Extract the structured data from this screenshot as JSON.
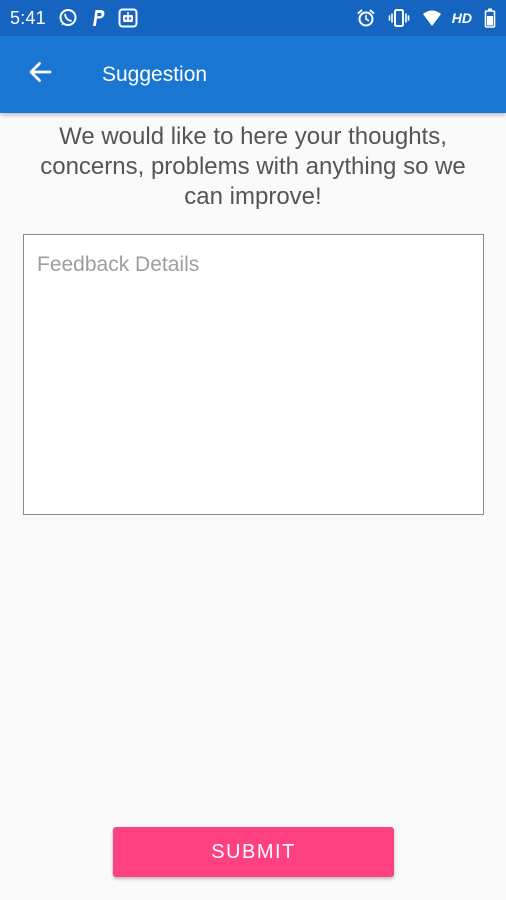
{
  "status_bar": {
    "time": "5:41",
    "left_icons": [
      "whatsapp-icon",
      "paypal-icon",
      "bot-app-icon"
    ],
    "right_icons": [
      "alarm-icon",
      "vibrate-icon",
      "wifi-icon",
      "battery-icon"
    ],
    "network_label": "HD"
  },
  "app_bar": {
    "title": "Suggestion",
    "back_icon": "arrow-back-icon",
    "color": "#1976d2"
  },
  "intro_text": "We would like to here your thoughts, concerns, problems with anything so we can improve!",
  "feedback": {
    "placeholder": "Feedback Details",
    "value": ""
  },
  "submit": {
    "label": "SUBMIT",
    "color": "#ff4081"
  }
}
